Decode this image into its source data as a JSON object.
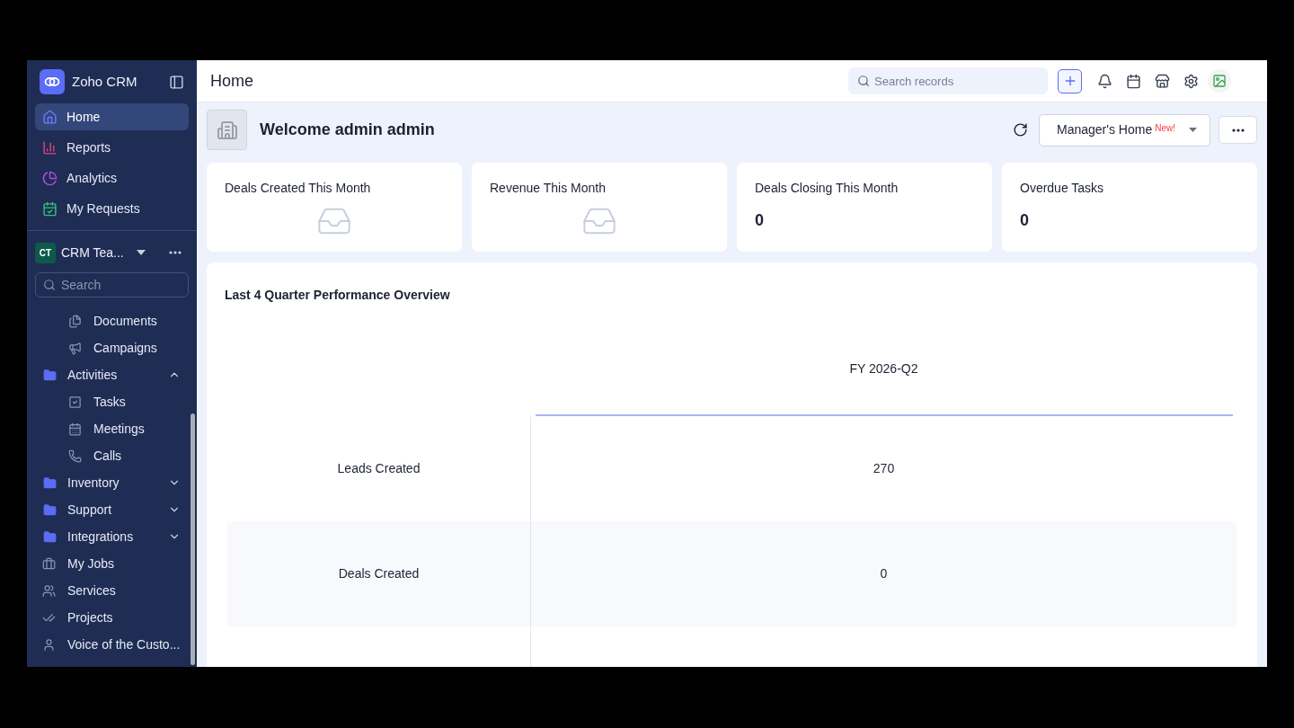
{
  "app": {
    "name": "Zoho CRM"
  },
  "sidebar": {
    "nav": [
      {
        "label": "Home",
        "selected": true
      },
      {
        "label": "Reports",
        "selected": false
      },
      {
        "label": "Analytics",
        "selected": false
      },
      {
        "label": "My Requests",
        "selected": false
      }
    ],
    "team": {
      "badge": "CT",
      "name": "CRM Tea..."
    },
    "search": {
      "placeholder": "Search"
    },
    "items": [
      {
        "kind": "sub",
        "label": "Documents"
      },
      {
        "kind": "sub",
        "label": "Campaigns"
      },
      {
        "kind": "folder",
        "label": "Activities",
        "expanded": true
      },
      {
        "kind": "sub",
        "label": "Tasks"
      },
      {
        "kind": "sub",
        "label": "Meetings"
      },
      {
        "kind": "sub",
        "label": "Calls"
      },
      {
        "kind": "folder",
        "label": "Inventory",
        "expanded": false
      },
      {
        "kind": "folder",
        "label": "Support",
        "expanded": false
      },
      {
        "kind": "folder",
        "label": "Integrations",
        "expanded": false
      },
      {
        "kind": "top",
        "label": "My Jobs"
      },
      {
        "kind": "top",
        "label": "Services"
      },
      {
        "kind": "top",
        "label": "Projects"
      },
      {
        "kind": "top",
        "label": "Voice of the Custo..."
      }
    ]
  },
  "header": {
    "title": "Home",
    "search": {
      "placeholder": "Search records"
    }
  },
  "welcome": {
    "text": "Welcome admin admin",
    "view": "Manager's Home",
    "view_badge": "New!"
  },
  "cards": [
    {
      "title": "Deals Created This Month",
      "kind": "empty"
    },
    {
      "title": "Revenue This Month",
      "kind": "empty"
    },
    {
      "title": "Deals Closing This Month",
      "kind": "value",
      "value": "0"
    },
    {
      "title": "Overdue Tasks",
      "kind": "value",
      "value": "0"
    }
  ],
  "performance": {
    "title": "Last 4 Quarter Performance Overview",
    "column": "FY 2026-Q2",
    "rows": [
      {
        "label": "Leads Created",
        "value": "270"
      },
      {
        "label": "Deals Created",
        "value": "0"
      }
    ]
  }
}
